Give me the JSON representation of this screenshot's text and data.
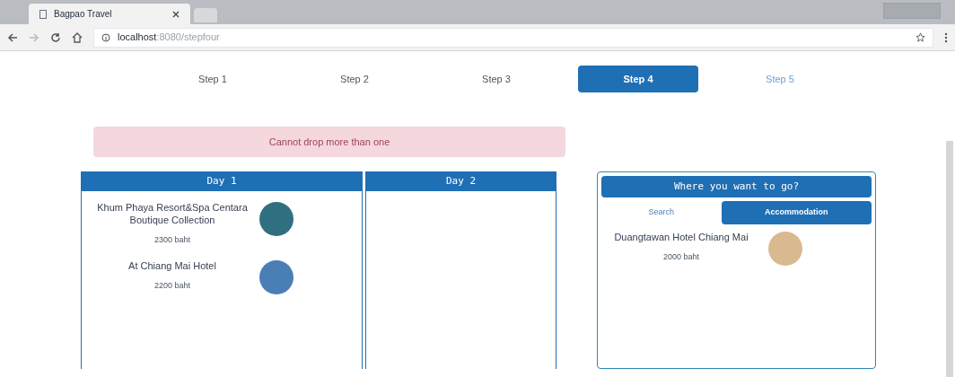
{
  "browser": {
    "tab_title": "Bagpao Travel",
    "url_host": "localhost",
    "url_path": ":8080/stepfour"
  },
  "steps": [
    {
      "label": "Step 1",
      "selected": false,
      "kind": "done"
    },
    {
      "label": "Step 2",
      "selected": false,
      "kind": "done"
    },
    {
      "label": "Step 3",
      "selected": false,
      "kind": "done"
    },
    {
      "label": "Step 4",
      "selected": true
    },
    {
      "label": "Step 5",
      "selected": false,
      "kind": "next"
    }
  ],
  "alert": "Cannot drop more than one",
  "days": [
    {
      "title": "Day 1",
      "items": [
        {
          "name": "Khum Phaya Resort&Spa Centara Boutique Collection",
          "price": "2300 baht"
        },
        {
          "name": "At Chiang Mai Hotel",
          "price": "2200 baht"
        }
      ]
    },
    {
      "title": "Day 2"
    }
  ],
  "panel": {
    "title": "Where you want to go?",
    "tabs": [
      {
        "label": "Search",
        "selected": false
      },
      {
        "label": "Accommodation",
        "selected": true
      }
    ],
    "items": [
      {
        "name": "Duangtawan Hotel Chiang Mai",
        "price": "2000 baht"
      }
    ]
  }
}
